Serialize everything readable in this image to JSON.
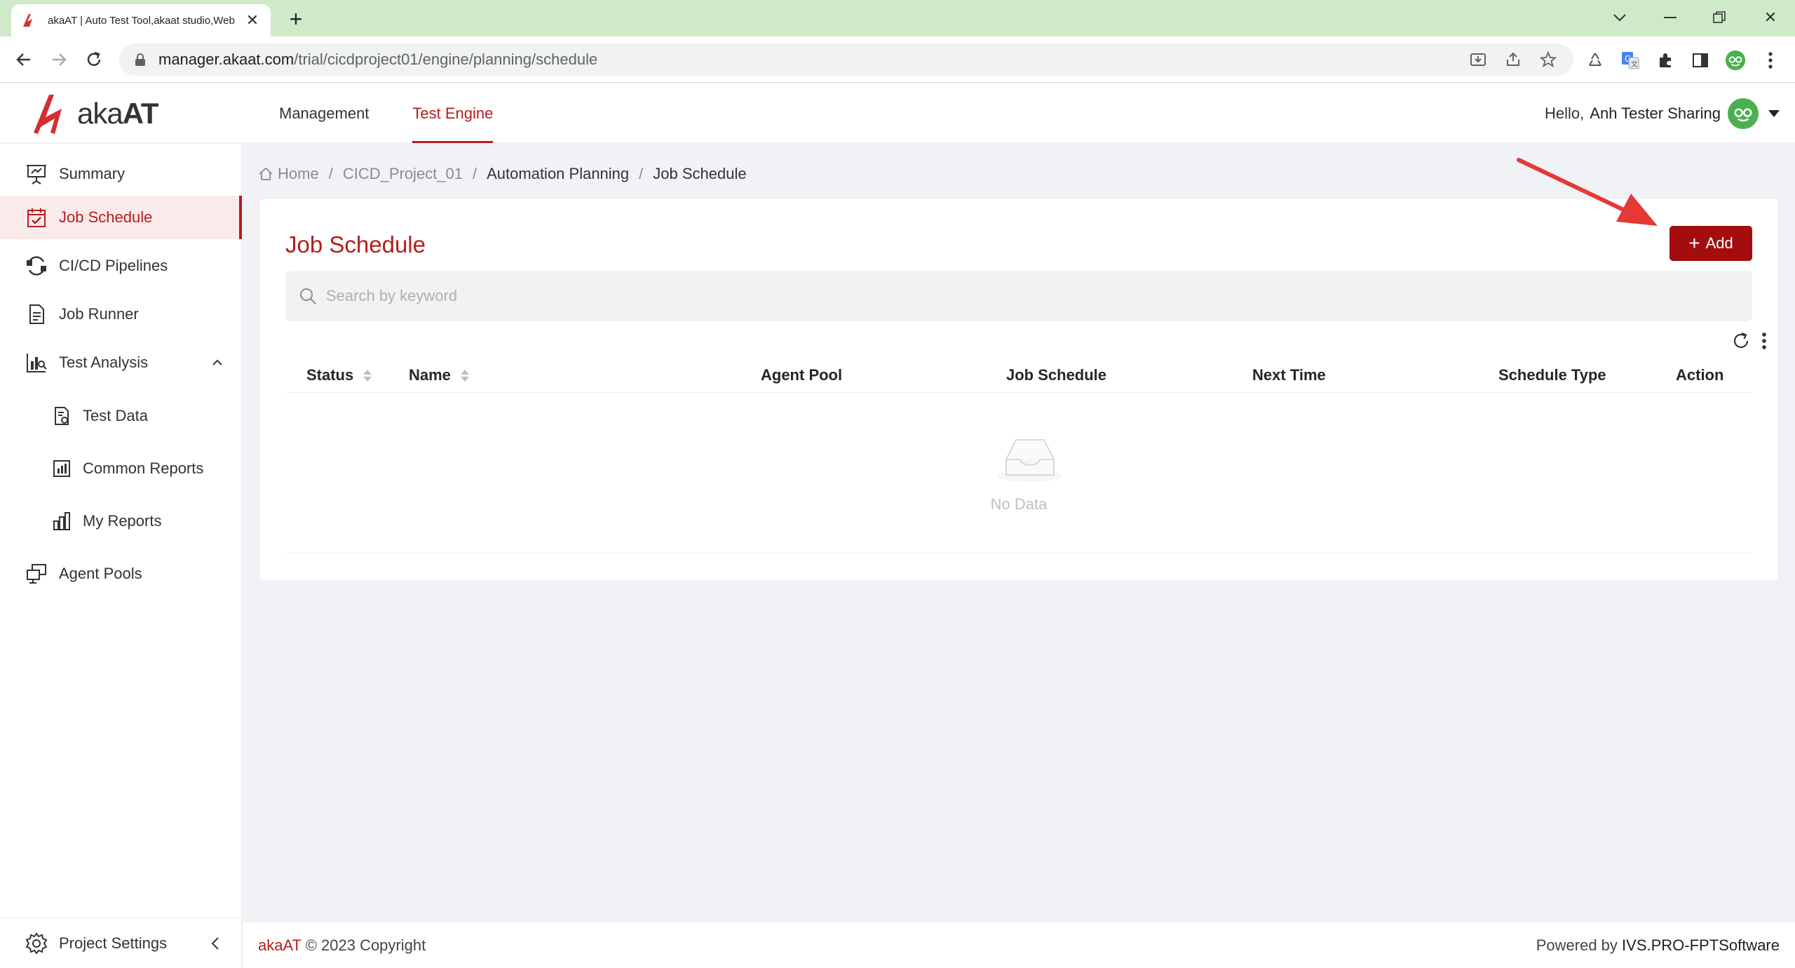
{
  "browser": {
    "tab_title": "akaAT | Auto Test Tool,akaat studio,Web",
    "url_host": "manager.akaat.com",
    "url_path": "/trial/cicdproject01/engine/planning/schedule"
  },
  "app": {
    "logo_aka": "aka",
    "logo_at": "AT",
    "nav": [
      "Management",
      "Test Engine"
    ],
    "active_nav": "Test Engine",
    "hello": "Hello,",
    "user_name": "Anh Tester Sharing",
    "accent_color": "#b71c1c"
  },
  "sidebar": {
    "items": [
      {
        "label": "Summary",
        "icon": "presentation-icon"
      },
      {
        "label": "Job Schedule",
        "icon": "calendar-check-icon",
        "active": true
      },
      {
        "label": "CI/CD Pipelines",
        "icon": "pipeline-icon"
      },
      {
        "label": "Job Runner",
        "icon": "document-icon"
      },
      {
        "label": "Test Analysis",
        "icon": "analysis-icon",
        "expanded": true
      },
      {
        "label": "Test Data",
        "icon": "data-file-icon",
        "sub": true
      },
      {
        "label": "Common Reports",
        "icon": "report-chart-icon",
        "sub": true
      },
      {
        "label": "My Reports",
        "icon": "bar-chart-icon",
        "sub": true
      },
      {
        "label": "Agent Pools",
        "icon": "monitors-icon"
      }
    ],
    "footer_label": "Project Settings"
  },
  "breadcrumb": {
    "home": "Home",
    "items": [
      "CICD_Project_01",
      "Automation Planning",
      "Job Schedule"
    ]
  },
  "main": {
    "title": "Job Schedule",
    "add_label": "Add",
    "search_placeholder": "Search by keyword",
    "columns": [
      "Status",
      "Name",
      "Agent Pool",
      "Job Schedule",
      "Next Time",
      "Schedule Type",
      "Action"
    ],
    "empty_text": "No Data"
  },
  "footer": {
    "brand": "akaAT",
    "copyright": "© 2023 Copyright",
    "powered_prefix": "Powered by",
    "powered_org": "IVS.PRO-FPTSoftware"
  }
}
